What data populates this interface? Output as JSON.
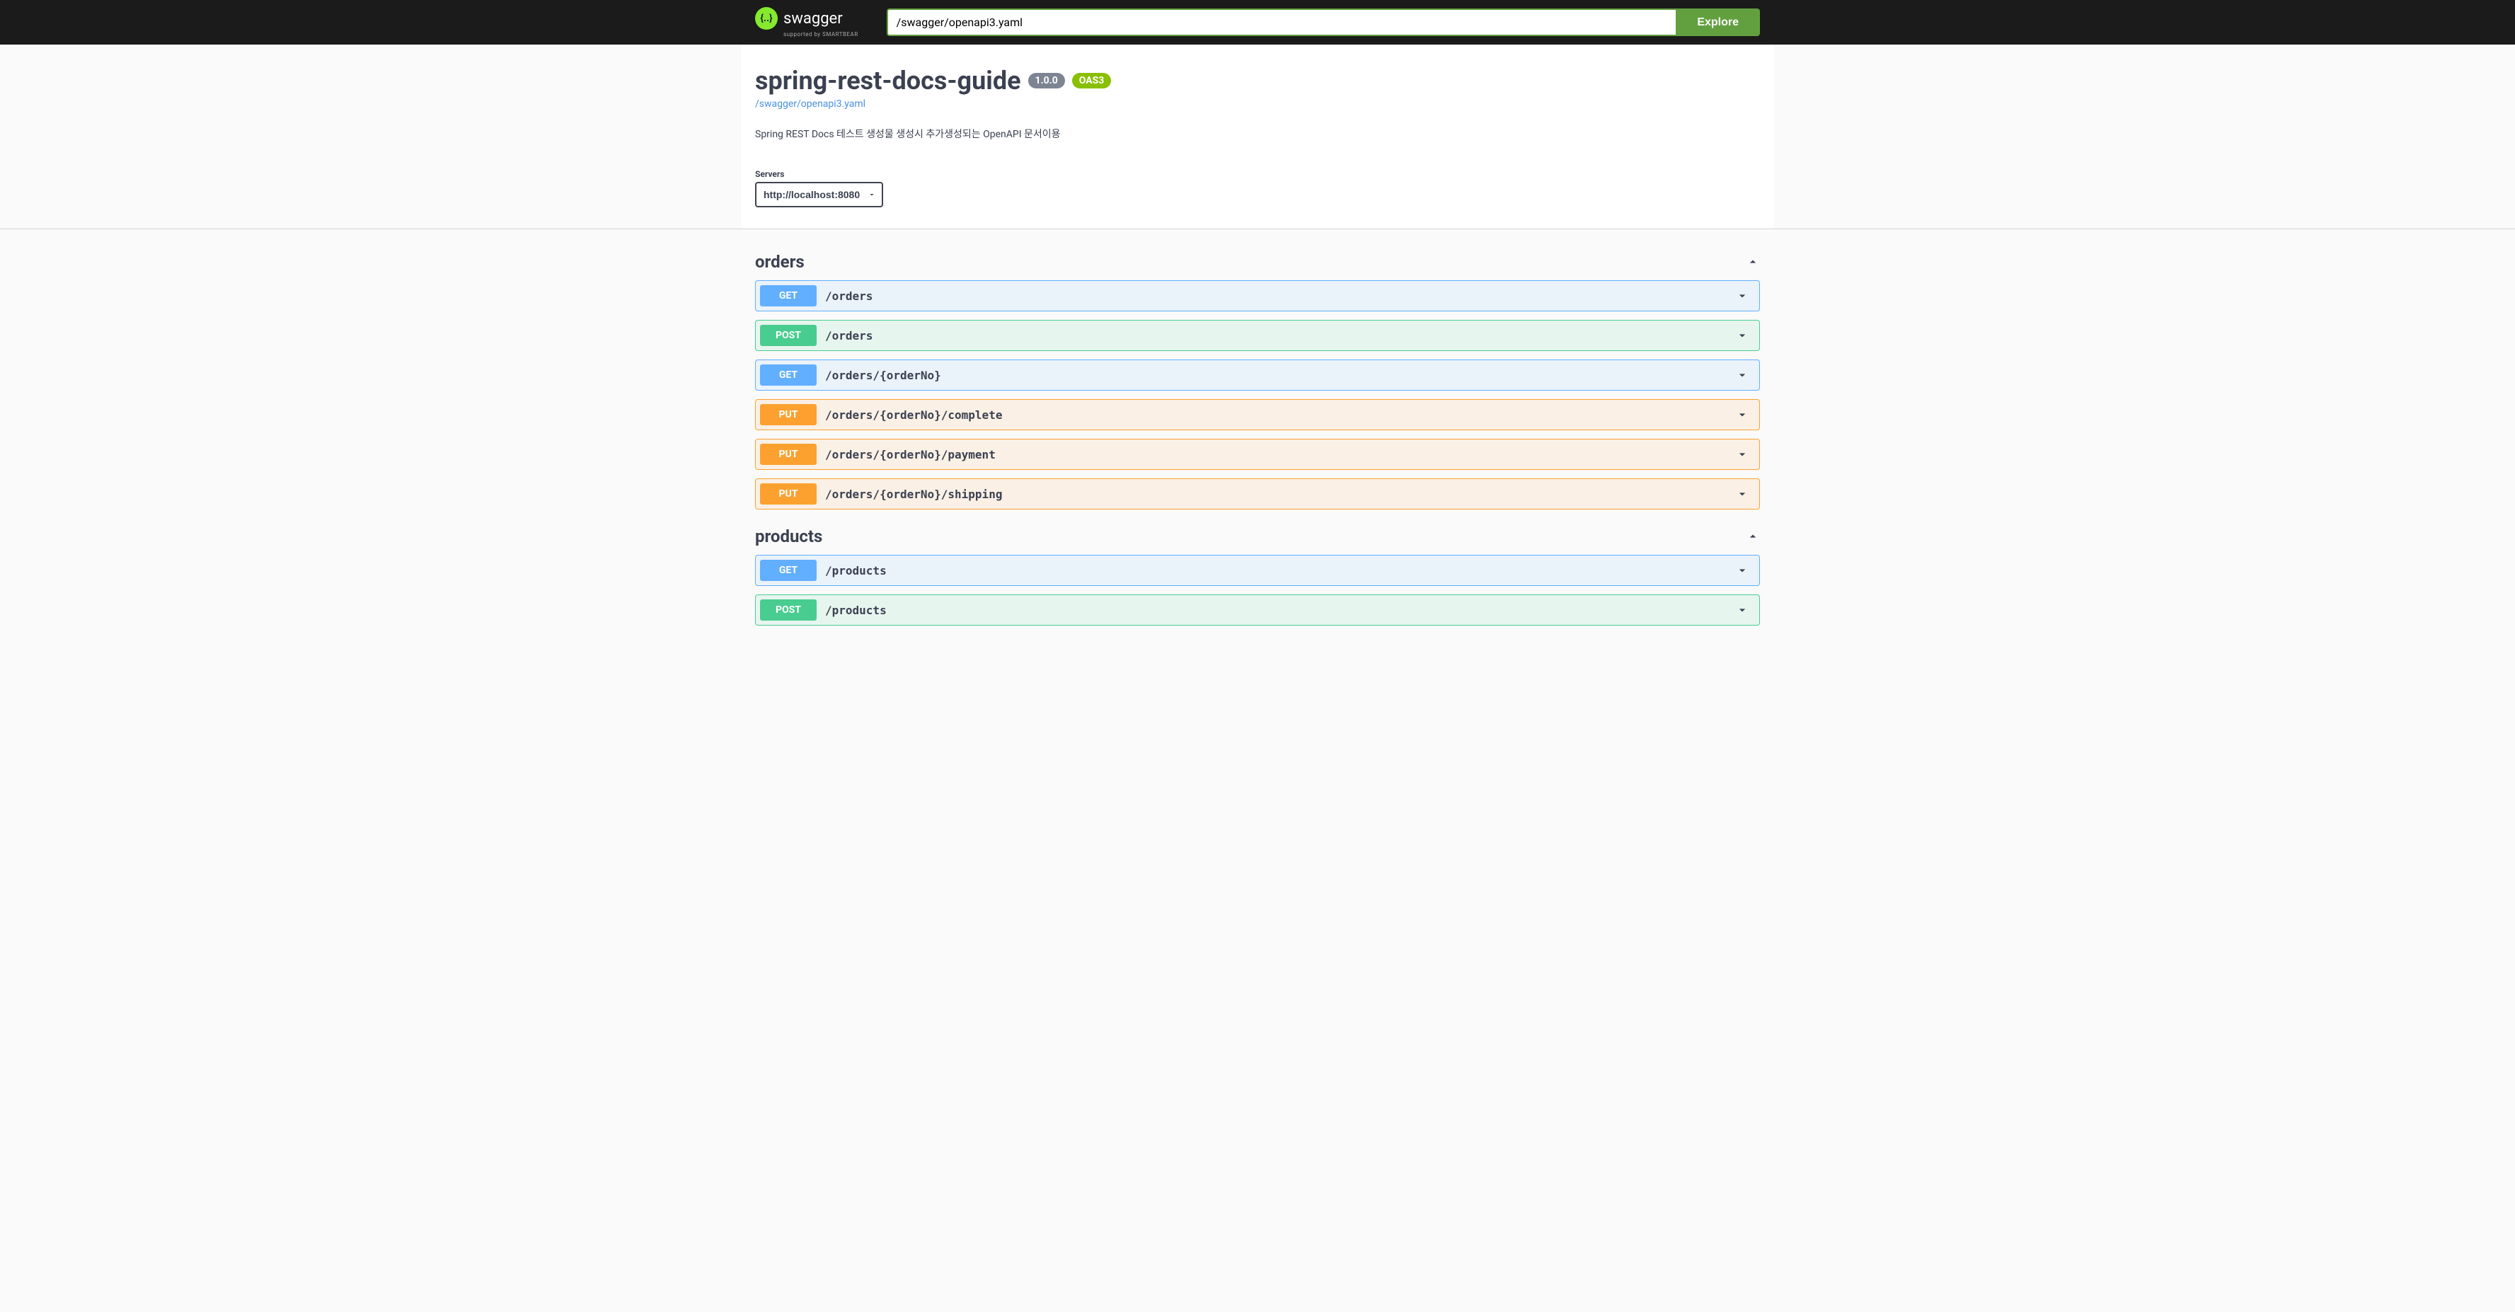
{
  "topbar": {
    "logo_text": "swagger",
    "logo_sub": "supported by SMARTBEAR",
    "search_value": "/swagger/openapi3.yaml",
    "explore_label": "Explore"
  },
  "info": {
    "title": "spring-rest-docs-guide",
    "version": "1.0.0",
    "oas": "OAS3",
    "spec_link": "/swagger/openapi3.yaml",
    "description": "Spring REST Docs 테스트 생성물 생성시 추가생성되는 OpenAPI 문서이용"
  },
  "servers": {
    "label": "Servers",
    "selected": "http://localhost:8080"
  },
  "tags": [
    {
      "name": "orders",
      "ops": [
        {
          "method": "GET",
          "path": "/orders"
        },
        {
          "method": "POST",
          "path": "/orders"
        },
        {
          "method": "GET",
          "path": "/orders/{orderNo}"
        },
        {
          "method": "PUT",
          "path": "/orders/{orderNo}/complete"
        },
        {
          "method": "PUT",
          "path": "/orders/{orderNo}/payment"
        },
        {
          "method": "PUT",
          "path": "/orders/{orderNo}/shipping"
        }
      ]
    },
    {
      "name": "products",
      "ops": [
        {
          "method": "GET",
          "path": "/products"
        },
        {
          "method": "POST",
          "path": "/products"
        }
      ]
    }
  ]
}
